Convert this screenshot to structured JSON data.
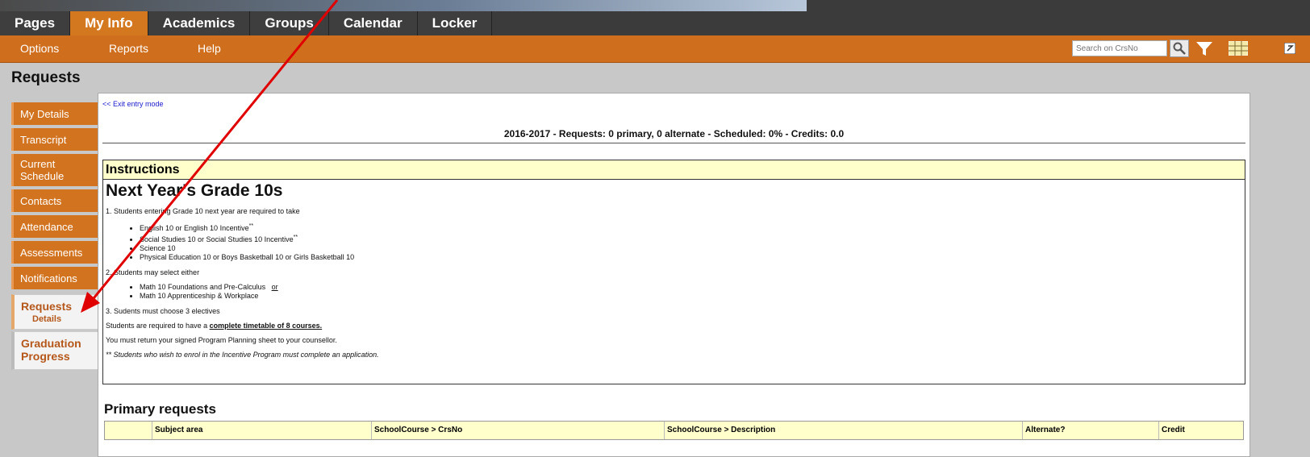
{
  "top_tabs": [
    "Pages",
    "My Info",
    "Academics",
    "Groups",
    "Calendar",
    "Locker"
  ],
  "submenu": {
    "options": "Options",
    "reports": "Reports",
    "help": "Help",
    "search_placeholder": "Search on CrsNo"
  },
  "page_title": "Requests",
  "sidenav": {
    "items": [
      "My Details",
      "Transcript",
      "Current Schedule",
      "Contacts",
      "Attendance",
      "Assessments",
      "Notifications"
    ],
    "requests": "Requests",
    "details": "Details",
    "graduation": "Graduation Progress"
  },
  "main": {
    "exit": "<< Exit entry mode",
    "summary": "2016-2017 - Requests: 0 primary, 0 alternate - Scheduled: 0% - Credits: 0.0",
    "instructions": {
      "header": "Instructions",
      "heading": "Next Year's Grade 10s",
      "p1": "1.  Students entering Grade 10 next year are required to take",
      "list1": [
        "English 10 or English 10 Incentive",
        "Social Studies 10 or Social Studies 10 Incentive",
        "Science 10",
        "Physical Education 10 or  Boys Basketball 10 or Girls Basketball 10"
      ],
      "star": "**",
      "p2": "2.  Students may select either",
      "list2": [
        "Math 10 Foundations and Pre-Calculus",
        "Math 10 Apprenticeship & Workplace"
      ],
      "or": "or",
      "p3": "3.  Sudents must choose 3 electives",
      "p4_pre": "Students are required to have a ",
      "p4_bold": "complete timetable of 8 courses.",
      "p5": "You must return your signed Program Planning sheet to your counsellor.",
      "p6": "** Students who wish to enrol in the Incentive Program must complete an application."
    },
    "primary_title": "Primary requests",
    "table_headers": [
      "",
      "Subject area",
      "SchoolCourse > CrsNo",
      "SchoolCourse > Description",
      "Alternate?",
      "Credit"
    ]
  },
  "colors": {
    "orange": "#cf6e1c",
    "dark": "#3b3b3b",
    "highlight": "#ffffcc",
    "arrow": "#e00000"
  }
}
